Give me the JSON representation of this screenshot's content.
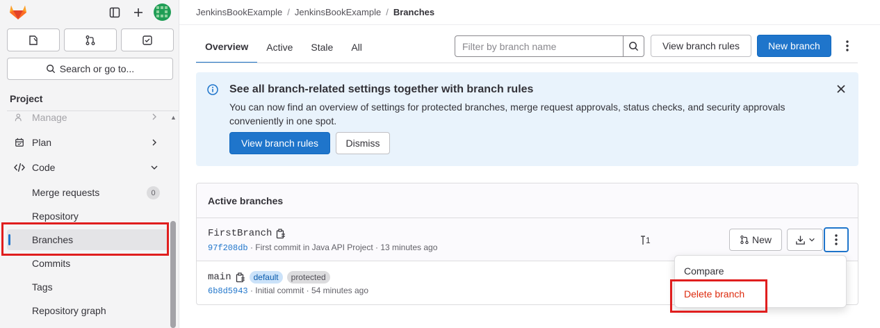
{
  "sidebar": {
    "search_label": "Search or go to...",
    "section_title": "Project",
    "items": [
      {
        "label": "Manage"
      },
      {
        "label": "Plan"
      },
      {
        "label": "Code"
      }
    ],
    "code_sub": [
      {
        "label": "Merge requests",
        "count": "0"
      },
      {
        "label": "Repository"
      },
      {
        "label": "Branches"
      },
      {
        "label": "Commits"
      },
      {
        "label": "Tags"
      },
      {
        "label": "Repository graph"
      }
    ]
  },
  "breadcrumb": {
    "group": "JenkinsBookExample",
    "project": "JenkinsBookExample",
    "current": "Branches",
    "sep": "/"
  },
  "tabs": [
    "Overview",
    "Active",
    "Stale",
    "All"
  ],
  "filter": {
    "placeholder": "Filter by branch name"
  },
  "header_buttons": {
    "view_rules": "View branch rules",
    "new_branch": "New branch"
  },
  "alert": {
    "title": "See all branch-related settings together with branch rules",
    "body": "You can now find an overview of settings for protected branches, merge request approvals, status checks, and security approvals conveniently in one spot.",
    "primary": "View branch rules",
    "secondary": "Dismiss"
  },
  "card": {
    "title": "Active branches",
    "branches": [
      {
        "name": "FirstBranch",
        "sha": "97f208db",
        "meta": " · First commit in Java API Project · 13 minutes ago",
        "divergence": "1"
      },
      {
        "name": "main",
        "sha": "6b8d5943",
        "meta": " · Initial commit · 54 minutes ago",
        "badges": [
          "default",
          "protected"
        ]
      }
    ],
    "new_mr_label": "New"
  },
  "dropdown": {
    "items": [
      "Compare",
      "Delete branch"
    ]
  },
  "colors": {
    "accent": "#1f75cb",
    "danger": "#dd2b0e",
    "highlight": "#e01e1e"
  }
}
